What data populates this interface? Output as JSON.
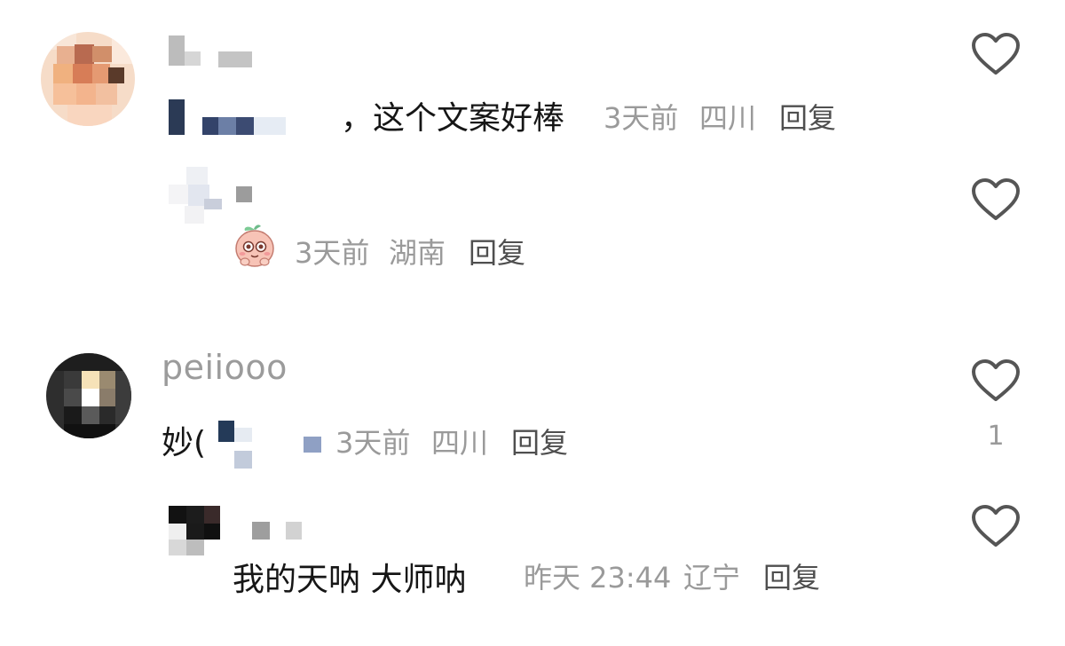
{
  "comments": [
    {
      "username": "",
      "content": "，这个文案好棒",
      "time": "3天前",
      "location": "四川",
      "reply_label": "回复",
      "like_count": "",
      "replies": [
        {
          "username": "",
          "content": "",
          "sticker": "peach-baby-sticker",
          "time": "3天前",
          "location": "湖南",
          "reply_label": "回复",
          "like_count": ""
        }
      ]
    },
    {
      "username": "peiiooo",
      "content": "妙(",
      "time": "3天前",
      "location": "四川",
      "reply_label": "回复",
      "like_count": "1",
      "replies": [
        {
          "username": "",
          "content": "我的天呐 大师呐",
          "time": "昨天 23:44",
          "location": "辽宁",
          "reply_label": "回复",
          "like_count": ""
        }
      ]
    }
  ],
  "icons": {
    "like": "heart-outline-icon"
  },
  "colors": {
    "text_primary": "#161616",
    "text_secondary": "#9a9a9a",
    "reply_text": "#4f4f4f",
    "heart_stroke": "#555555"
  }
}
